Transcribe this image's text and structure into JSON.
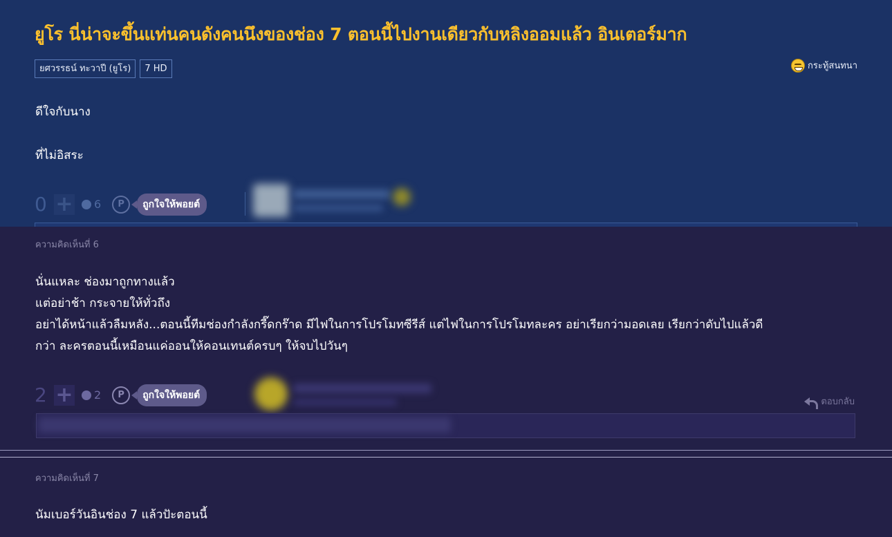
{
  "topic": {
    "title": "ยูโร นี่น่าจะขึ้นแท่นคนดังคนนึงของช่อง 7 ตอนนี้ไปงานเดียวกับหลิงออมแล้ว อินเตอร์มาก",
    "tags": [
      "ยศวรรธน์ ทะวาปี (ยูโร)",
      "7 HD"
    ],
    "kind_label": "กระทู้สนทนา",
    "kind_icon": "laugh-emoji-icon",
    "body_lines": [
      "ดีใจกับนาง",
      "ที่ไม่อิสระ"
    ],
    "votes": "0",
    "emotion_count": "6",
    "point_label": "ถูกใจให้พอยต์"
  },
  "comments": [
    {
      "label": "ความคิดเห็นที่ 6",
      "lines": [
        "นั่นแหละ ช่องมาถูกทางแล้ว",
        "แต่อย่าช้า กระจายให้ทั่วถึง",
        "อย่าได้หน้าแล้วลืมหลัง...ตอนนี้ทีมช่องกำลังกรี๊ดกร๊าด มีไฟในการโปรโมทซีรีส์ แต่ไฟในการโปรโมทละคร อย่าเรียกว่ามอดเลย เรียกว่าดับไปแล้วดี",
        "กว่า ละครตอนนี้เหมือนแค่ออนให้คอนเทนต์ครบๆ ให้จบไปวันๆ"
      ],
      "votes": "2",
      "emotion_count": "2",
      "point_label": "ถูกใจให้พอยต์",
      "reply_label": "ตอบกลับ"
    },
    {
      "label": "ความคิดเห็นที่ 7",
      "lines": [
        "นัมเบอร์วันอินช่อง 7 แล้วปัะตอนนี้"
      ]
    }
  ],
  "colors": {
    "topic_bg": "#1b3265",
    "comment_bg": "#232047",
    "title": "#fbc02d",
    "point_pill": "#5e5a8a"
  }
}
